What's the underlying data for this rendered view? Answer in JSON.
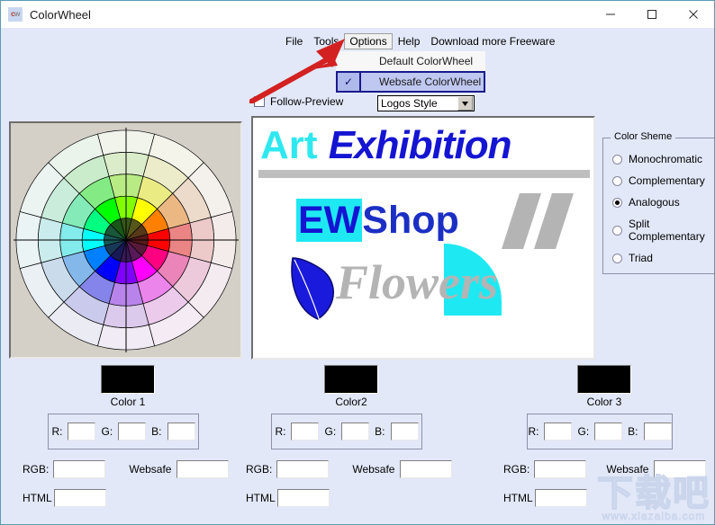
{
  "window": {
    "title": "ColorWheel",
    "icon_text_c": "c",
    "icon_text_w": "w",
    "minimize": "—",
    "maximize": "□",
    "close": "✕"
  },
  "menubar": {
    "items": [
      {
        "label": "File",
        "active": false
      },
      {
        "label": "Tools",
        "active": false
      },
      {
        "label": "Options",
        "active": true
      },
      {
        "label": "Help",
        "active": false
      },
      {
        "label": "Download more Freeware",
        "active": false
      }
    ]
  },
  "dropdown": {
    "items": [
      {
        "label": "Default ColorWheel",
        "selected": false
      },
      {
        "label": "Websafe ColorWheel",
        "selected": true
      }
    ],
    "check_glyph": "✓"
  },
  "options_row": {
    "follow_preview_label": "Follow-Preview",
    "follow_preview_checked": false,
    "style_select_value": "Logos Style",
    "style_select_arrow": "▼"
  },
  "preview": {
    "art_word": "Art",
    "exhibition_word": "Exhibition",
    "ew_badge": "EW",
    "shop_word": "Shop",
    "flowers_word": "Flowers",
    "colors": {
      "cyan": "#1EE9F2",
      "blue": "#1414D2",
      "gray": "#B4B4B4",
      "bar_gray": "#BEBEBE"
    }
  },
  "scheme": {
    "legend": "Color Sheme",
    "options": [
      {
        "label": "Monochromatic",
        "selected": false
      },
      {
        "label": "Complementary",
        "selected": false
      },
      {
        "label": "Analogous",
        "selected": true
      },
      {
        "label": "Split Complementary",
        "selected": false
      },
      {
        "label": "Triad",
        "selected": false
      }
    ]
  },
  "colors": [
    {
      "swatch_label": "Color 1",
      "swatch_hex": "#000000",
      "r_label": "R:",
      "g_label": "G:",
      "b_label": "B:",
      "r_value": "",
      "g_value": "",
      "b_value": "",
      "rgb_label": "RGB:",
      "rgb_value": "",
      "websafe_label": "Websafe",
      "websafe_value": "",
      "html_label": "HTML",
      "html_value": ""
    },
    {
      "swatch_label": "Color2",
      "swatch_hex": "#000000",
      "r_label": "R:",
      "g_label": "G:",
      "b_label": "B:",
      "r_value": "",
      "g_value": "",
      "b_value": "",
      "rgb_label": "RGB:",
      "rgb_value": "",
      "websafe_label": "Websafe",
      "websafe_value": "",
      "html_label": "HTML",
      "html_value": ""
    },
    {
      "swatch_label": "Color 3",
      "swatch_hex": "#000000",
      "r_label": "R:",
      "g_label": "G:",
      "b_label": "B:",
      "r_value": "",
      "g_value": "",
      "b_value": "",
      "rgb_label": "RGB:",
      "rgb_value": "",
      "websafe_label": "Websafe",
      "websafe_value": "",
      "html_label": "HTML",
      "html_value": ""
    }
  ],
  "wheel": {
    "sectors": 12,
    "rings": 5,
    "hues": [
      90,
      60,
      30,
      0,
      330,
      300,
      270,
      240,
      210,
      180,
      150,
      120
    ]
  },
  "annotation": {
    "arrow_color": "#D32121"
  },
  "watermark": {
    "cn": "下载吧",
    "url": "www.xiazaiba.com"
  }
}
